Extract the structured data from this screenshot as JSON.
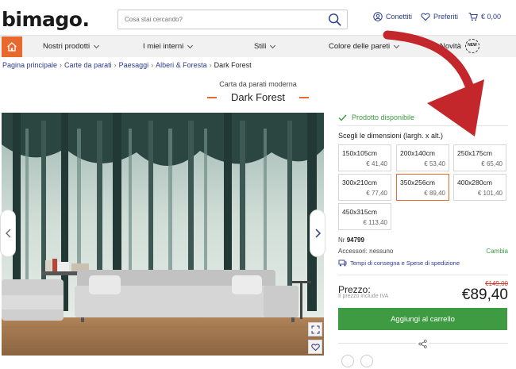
{
  "header": {
    "logo": "bimago.",
    "search_placeholder": "Cosa stai cercando?",
    "account_label": "Conettiti",
    "favorites_label": "Preferiti",
    "cart_label": "€ 0,00"
  },
  "nav": {
    "items": [
      "Nostri prodotti",
      "I miei interni",
      "Stili",
      "Colore delle pareti",
      "Novità"
    ],
    "new_badge": "NEW"
  },
  "breadcrumb": [
    "Pagina principale",
    "Carte da parati",
    "Paesaggi",
    "Alberi & Foresta",
    "Dark Forest"
  ],
  "product": {
    "subtitle": "Carta da parati moderna",
    "title": "Dark Forest",
    "availability": "Prodotto disponibile",
    "size_label": "Scegli le dimensioni (largh. x alt.)",
    "sizes": [
      {
        "dim": "150x105cm",
        "price": "€ 41,40"
      },
      {
        "dim": "200x140cm",
        "price": "€ 53,40"
      },
      {
        "dim": "250x175cm",
        "price": "€ 65,40"
      },
      {
        "dim": "300x210cm",
        "price": "€ 77,40"
      },
      {
        "dim": "350x256cm",
        "price": "€ 89,40"
      },
      {
        "dim": "400x280cm",
        "price": "€ 101,40"
      },
      {
        "dim": "450x315cm",
        "price": "€ 113,40"
      }
    ],
    "selected_size": "350x256cm",
    "nr_label": "Nr",
    "nr_value": "94799",
    "accessories_label": "Accessori: nessuno",
    "change_label": "Cambia",
    "shipping_label": "Tempi di consegna e Spese di spedizione",
    "price_label": "Prezzo:",
    "vat_label": "Il prezzo include IVA",
    "old_price": "€149,00",
    "price": "€89,40",
    "cart_button": "Aggiungi al carrello"
  },
  "colors": {
    "accent": "#e8682d",
    "brand_blue": "#2a3a8c",
    "green": "#3f9b41",
    "annotation_red": "#c3262b"
  }
}
